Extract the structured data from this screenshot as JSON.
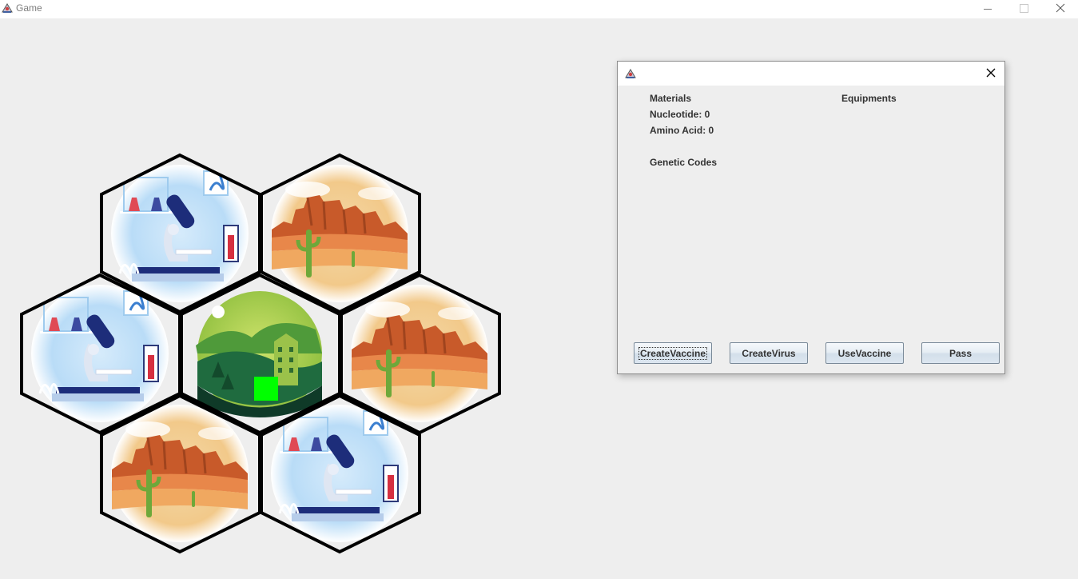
{
  "window": {
    "title": "Game"
  },
  "board": {
    "tiles": [
      {
        "type": "laboratory"
      },
      {
        "type": "desert"
      },
      {
        "type": "laboratory"
      },
      {
        "type": "city"
      },
      {
        "type": "desert"
      },
      {
        "type": "desert"
      },
      {
        "type": "laboratory"
      }
    ],
    "player_marker_color": "#00ff00",
    "player_tile": "city"
  },
  "panel": {
    "materials_label": "Materials",
    "nucleotide_label": "Nucleotide: 0",
    "amino_acid_label": "Amino Acid: 0",
    "genetic_codes_label": "Genetic Codes",
    "equipments_label": "Equipments",
    "buttons": {
      "create_vaccine": "CreateVaccine",
      "create_virus": "CreateVirus",
      "use_vaccine": "UseVaccine",
      "pass": "Pass"
    }
  },
  "colors": {
    "background": "#eeeeee",
    "hex_border": "#000000"
  }
}
